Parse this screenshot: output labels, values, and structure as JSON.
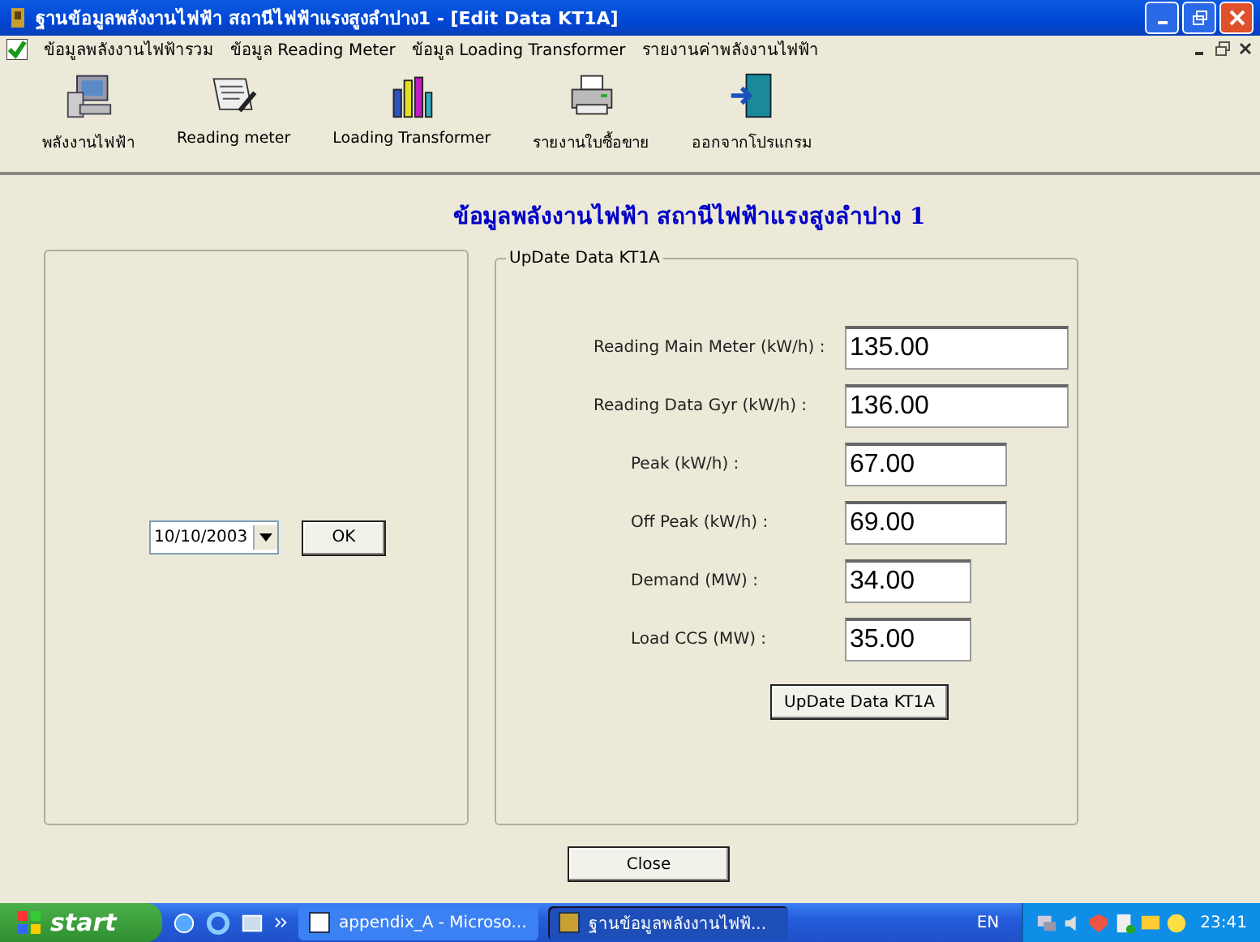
{
  "window": {
    "title": "ฐานข้อมูลพลังงานไฟฟ้า สถานีไฟฟ้าแรงสูงลำปาง1  - [Edit Data KT1A]"
  },
  "menu": [
    "ข้อมูลพลังงานไฟฟ้ารวม",
    "ข้อมูล Reading Meter",
    "ข้อมูล Loading Transformer",
    "รายงานค่าพลังงานไฟฟ้า"
  ],
  "toolbar": [
    {
      "kind": "computer",
      "label": "พลังงานไฟฟ้า"
    },
    {
      "kind": "paper",
      "label": "Reading meter"
    },
    {
      "kind": "bars",
      "label": "Loading Transformer"
    },
    {
      "kind": "printer",
      "label": "รายงานใบซื้อขาย"
    },
    {
      "kind": "exit",
      "label": "ออกจากโปรแกรม"
    }
  ],
  "heading": "ข้อมูลพลังงานไฟฟ้า สถานีไฟฟ้าแรงสูงลำปาง 1",
  "date_picker": {
    "value": "10/10/2003"
  },
  "ok_button": "OK",
  "update_group": {
    "title": "UpDate Data KT1A",
    "fields": [
      {
        "label": "Reading Main Meter (kW/h) :",
        "value": "135.00"
      },
      {
        "label": "Reading Data Gyr (kW/h) :",
        "value": "136.00"
      },
      {
        "label": "Peak (kW/h) :",
        "value": "67.00"
      },
      {
        "label": "Off Peak (kW/h) :",
        "value": "69.00"
      },
      {
        "label": "Demand (MW) :",
        "value": "34.00"
      },
      {
        "label": "Load CCS (MW) :",
        "value": "35.00"
      }
    ],
    "button": "UpDate Data KT1A"
  },
  "close_button": "Close",
  "taskbar": {
    "start": "start",
    "tasks": [
      {
        "label": "appendix_A - Microso...",
        "selected": false
      },
      {
        "label": "ฐานข้อมูลพลังงานไฟฟ้...",
        "selected": true
      }
    ],
    "language": "EN",
    "clock": "23:41"
  }
}
